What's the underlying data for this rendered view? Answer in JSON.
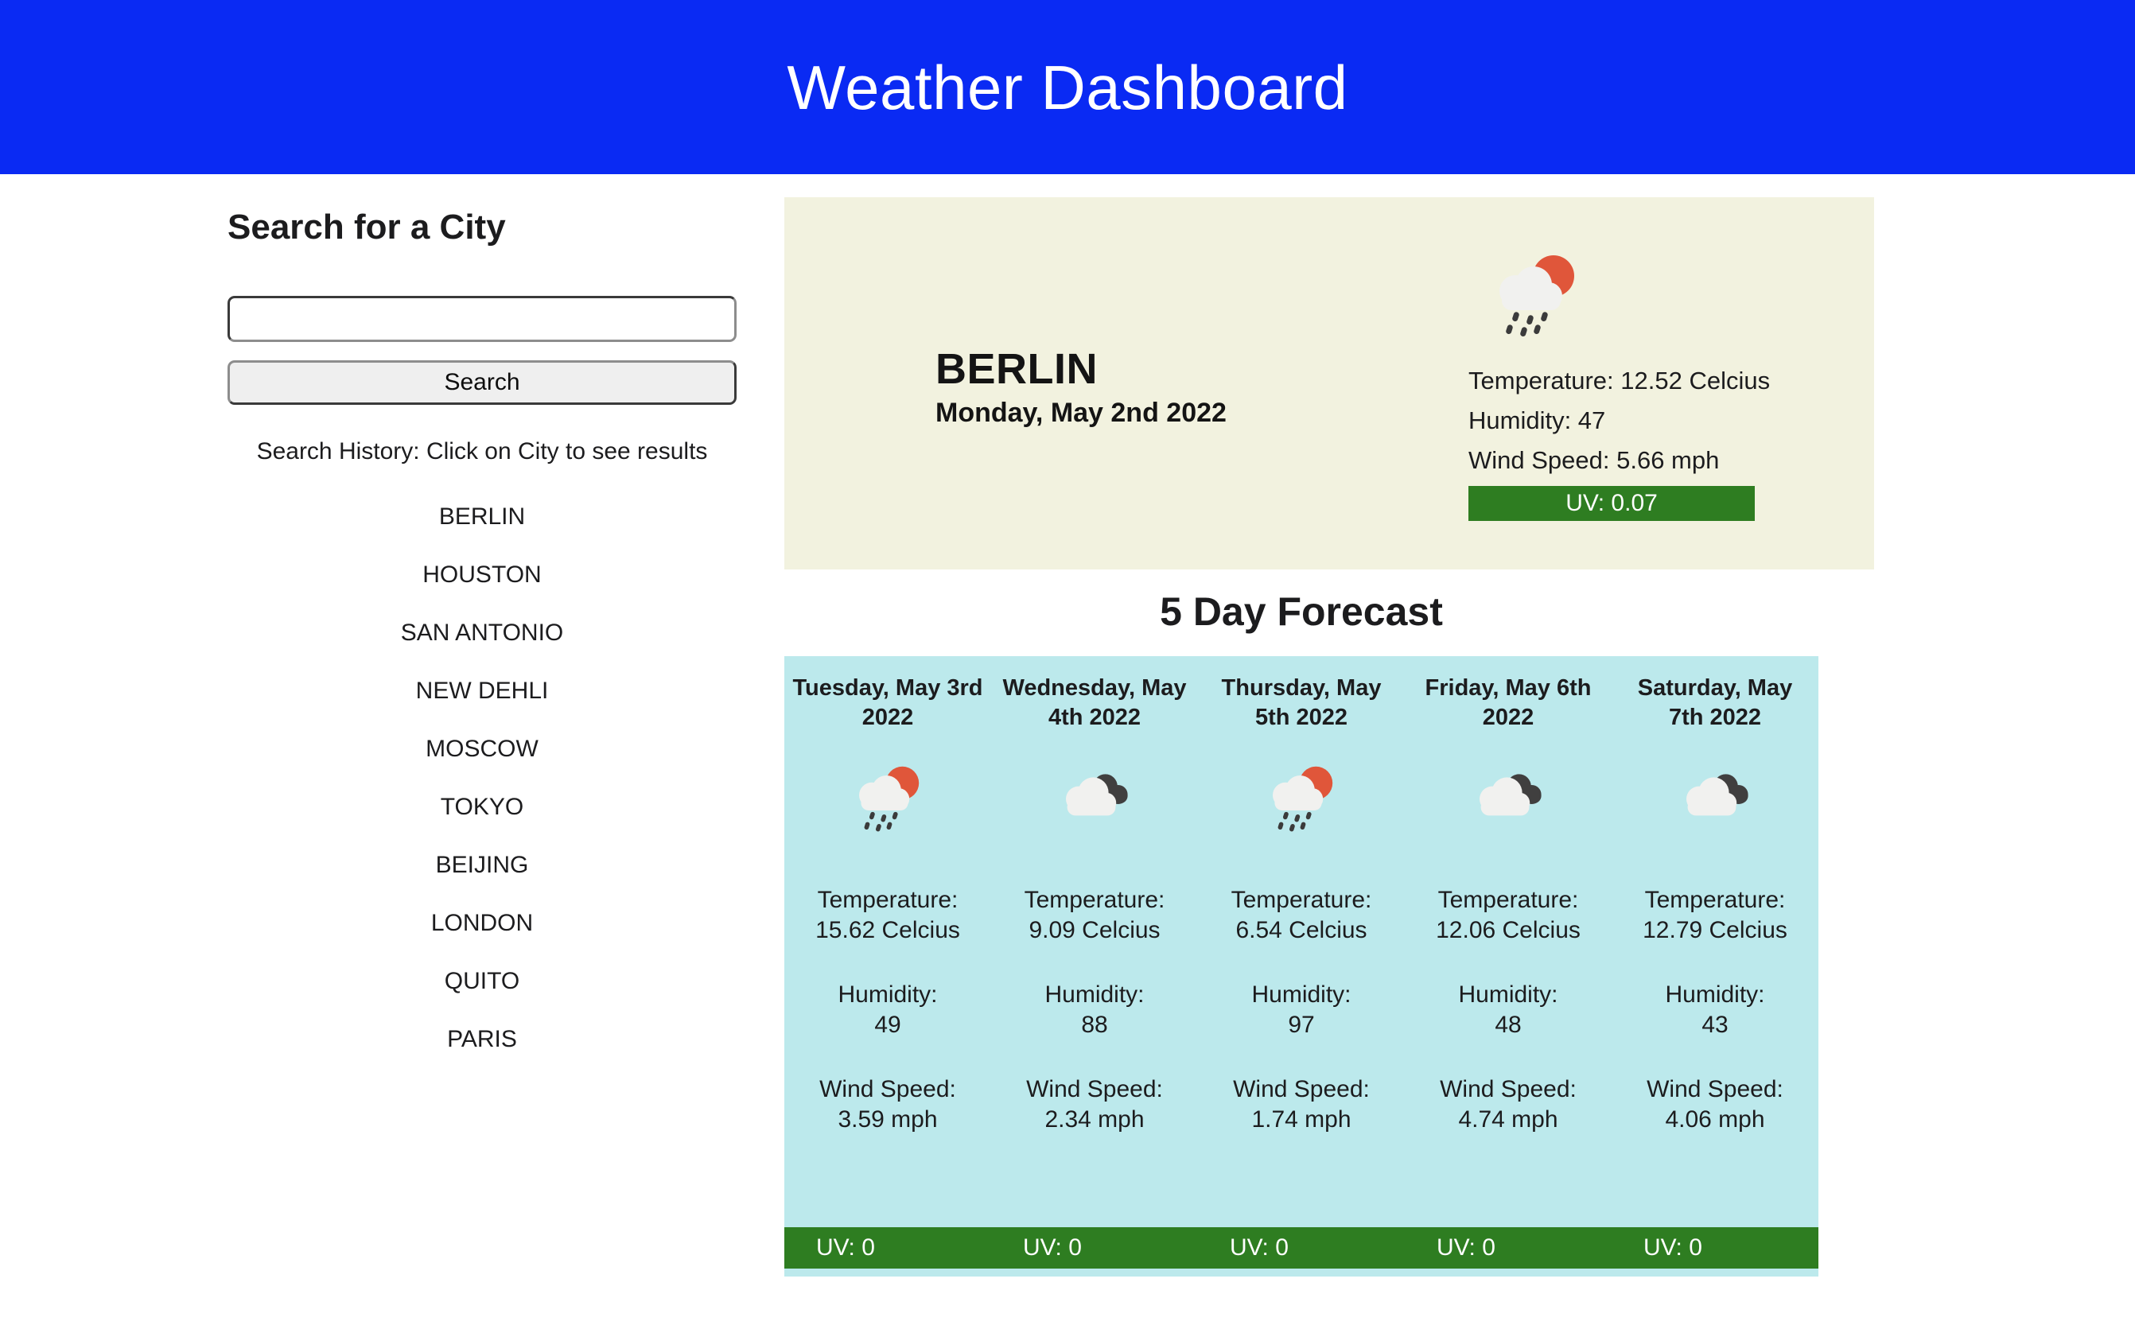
{
  "header": {
    "title": "Weather Dashboard",
    "bg_color": "#0a2af3"
  },
  "sidebar": {
    "heading": "Search for a City",
    "search_input": {
      "value": "",
      "placeholder": ""
    },
    "search_button_label": "Search",
    "history_label": "Search History: Click on City to see results",
    "history": [
      {
        "name": "BERLIN"
      },
      {
        "name": "HOUSTON"
      },
      {
        "name": "SAN ANTONIO"
      },
      {
        "name": "NEW DEHLI"
      },
      {
        "name": "MOSCOW"
      },
      {
        "name": "TOKYO"
      },
      {
        "name": "BEIJING"
      },
      {
        "name": "LONDON"
      },
      {
        "name": "QUITO"
      },
      {
        "name": "PARIS"
      }
    ]
  },
  "current": {
    "city": "BERLIN",
    "date": "Monday, May 2nd 2022",
    "icon": "sun-behind-rain-cloud-icon",
    "temperature": "Temperature: 12.52 Celcius",
    "humidity": "Humidity: 47",
    "wind_speed": "Wind Speed: 5.66 mph",
    "uv": "UV: 0.07",
    "card_color": "#f2f2df",
    "uv_badge_color": "#2e7d21"
  },
  "forecast": {
    "heading": "5 Day Forecast",
    "panel_color": "#bce9ec",
    "uv_bar_color": "#2e7d21",
    "days": [
      {
        "date": "Tuesday, May 3rd 2022",
        "icon": "sun-behind-rain-cloud-icon",
        "temperature_label": "Temperature:",
        "temperature_value": "15.62 Celcius",
        "humidity_label": "Humidity:",
        "humidity_value": "49",
        "wind_label": "Wind Speed:",
        "wind_value": "3.59 mph",
        "uv": "UV: 0"
      },
      {
        "date": "Wednesday, May 4th 2022",
        "icon": "broken-clouds-icon",
        "temperature_label": "Temperature:",
        "temperature_value": "9.09 Celcius",
        "humidity_label": "Humidity:",
        "humidity_value": "88",
        "wind_label": "Wind Speed:",
        "wind_value": "2.34 mph",
        "uv": "UV: 0"
      },
      {
        "date": "Thursday, May 5th 2022",
        "icon": "sun-behind-rain-cloud-icon",
        "temperature_label": "Temperature:",
        "temperature_value": "6.54 Celcius",
        "humidity_label": "Humidity:",
        "humidity_value": "97",
        "wind_label": "Wind Speed:",
        "wind_value": "1.74 mph",
        "uv": "UV: 0"
      },
      {
        "date": "Friday, May 6th 2022",
        "icon": "broken-clouds-icon",
        "temperature_label": "Temperature:",
        "temperature_value": "12.06 Celcius",
        "humidity_label": "Humidity:",
        "humidity_value": "48",
        "wind_label": "Wind Speed:",
        "wind_value": "4.74 mph",
        "uv": "UV: 0"
      },
      {
        "date": "Saturday, May 7th 2022",
        "icon": "broken-clouds-icon",
        "temperature_label": "Temperature:",
        "temperature_value": "12.79 Celcius",
        "humidity_label": "Humidity:",
        "humidity_value": "43",
        "wind_label": "Wind Speed:",
        "wind_value": "4.06 mph",
        "uv": "UV: 0"
      }
    ]
  },
  "icon_colors": {
    "sun": "#e0563a",
    "cloud_light": "#f1f1ef",
    "cloud_dark": "#403f3f",
    "raindrop": "#3b3b3b"
  }
}
